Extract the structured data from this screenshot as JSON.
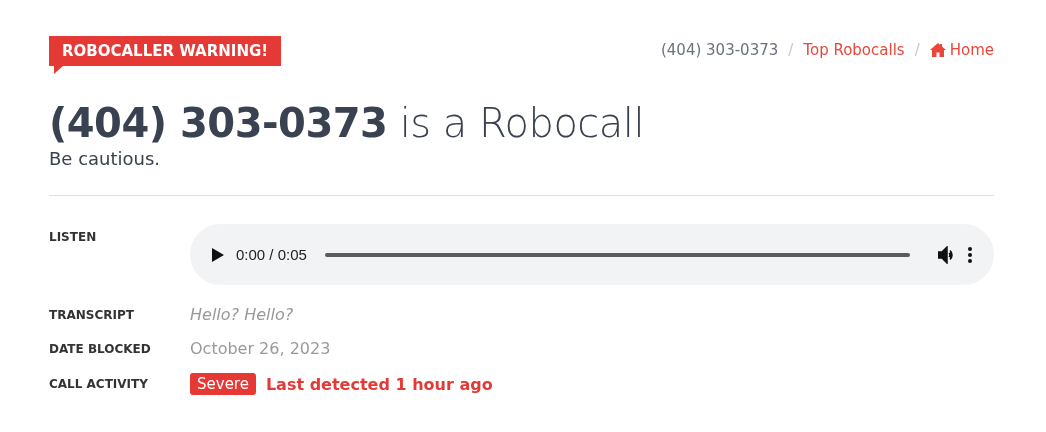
{
  "badge": "ROBOCALLER WARNING!",
  "breadcrumb": {
    "separator": "/",
    "items": [
      {
        "label": "(404) 303-0373",
        "kind": "current"
      },
      {
        "label": "Top Robocalls",
        "kind": "link"
      },
      {
        "label": "Home",
        "kind": "home"
      }
    ]
  },
  "heading": "**(404) 303-0373** is a Robocall",
  "subheading": "Be cautious.",
  "details": [
    {
      "label": "LISTEN",
      "kind": "audio",
      "time": "0:00 / 0:05"
    },
    {
      "label": "TRANSCRIPT",
      "kind": "transcript",
      "value": "Hello? Hello?"
    },
    {
      "label": "DATE BLOCKED",
      "kind": "date",
      "value": "October 26, 2023"
    },
    {
      "label": "CALL ACTIVITY",
      "kind": "activity",
      "tag": "Severe",
      "value": "Last detected 1 hour ago"
    }
  ]
}
